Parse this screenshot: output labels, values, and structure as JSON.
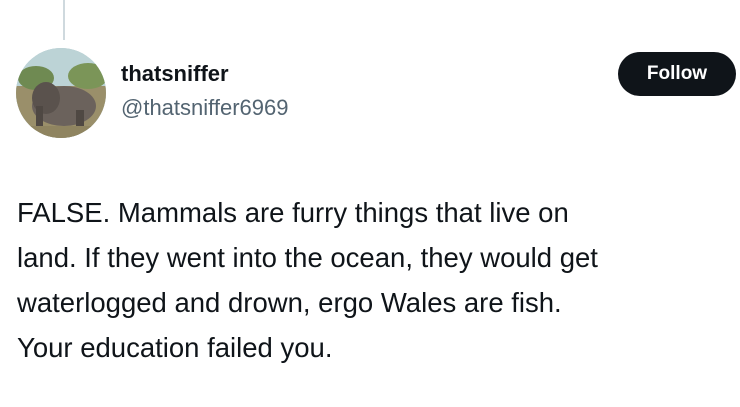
{
  "user": {
    "display_name": "thatsniffer",
    "handle": "@thatsniffer6969",
    "avatar_icon": "elephant-photo-avatar"
  },
  "follow_button": {
    "label": "Follow"
  },
  "tweet": {
    "lines": [
      "FALSE. Mammals are furry things that live on",
      "land. If they went into the ocean, they would get",
      "waterlogged and drown, ergo Wales are fish.",
      "Your education failed you."
    ]
  },
  "colors": {
    "text_primary": "#0f1419",
    "text_secondary": "#536471",
    "button_bg": "#0f1419",
    "button_text": "#ffffff",
    "thread_line": "#cfd9de"
  }
}
